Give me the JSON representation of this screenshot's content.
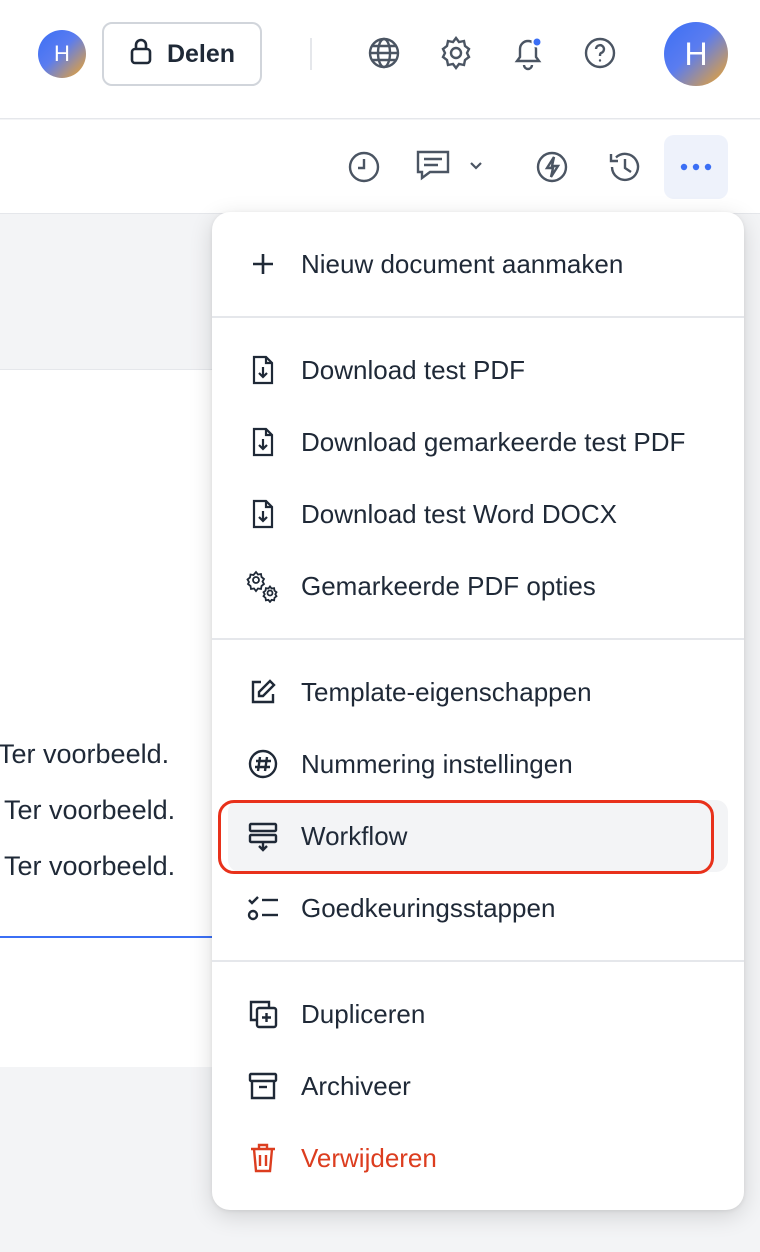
{
  "header": {
    "user_initial": "H",
    "share_label": "Delen",
    "profile_initial": "H"
  },
  "document": {
    "lines": [
      "Ter voorbeeld.",
      "Ter voorbeeld.",
      "Ter voorbeeld."
    ]
  },
  "menu": {
    "groups": [
      [
        {
          "label": "Nieuw document aanmaken",
          "icon": "plus-icon"
        }
      ],
      [
        {
          "label": "Download test PDF",
          "icon": "file-download-icon"
        },
        {
          "label": "Download gemarkeerde test PDF",
          "icon": "file-download-icon"
        },
        {
          "label": "Download test Word DOCX",
          "icon": "file-download-icon"
        },
        {
          "label": "Gemarkeerde PDF opties",
          "icon": "gears-icon"
        }
      ],
      [
        {
          "label": "Template-eigenschappen",
          "icon": "edit-icon"
        },
        {
          "label": "Nummering instellingen",
          "icon": "hash-icon"
        },
        {
          "label": "Workflow",
          "icon": "workflow-icon"
        },
        {
          "label": "Goedkeuringsstappen",
          "icon": "checklist-icon"
        }
      ],
      [
        {
          "label": "Dupliceren",
          "icon": "duplicate-icon"
        },
        {
          "label": "Archiveer",
          "icon": "archive-icon"
        },
        {
          "label": "Verwijderen",
          "icon": "trash-icon"
        }
      ]
    ]
  },
  "colors": {
    "accent": "#3b6ff5",
    "danger": "#dc3d1f",
    "highlight": "#e8311b"
  }
}
